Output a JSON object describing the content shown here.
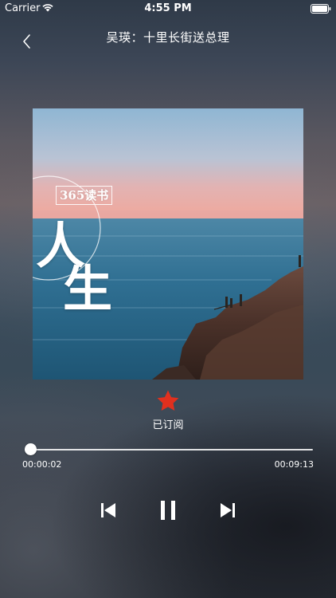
{
  "status_bar": {
    "carrier": "Carrier",
    "time": "4:55 PM",
    "icons": [
      "wifi-icon",
      "battery-icon"
    ]
  },
  "nav": {
    "back_icon": "chevron-left-icon",
    "title": "吴瑛：十里长街送总理"
  },
  "cover": {
    "stamp_text": "365读书",
    "big_char_1": "人",
    "big_char_2": "生"
  },
  "subscribe": {
    "icon": "star-icon",
    "label": "已订阅",
    "color": "#e0301e"
  },
  "player": {
    "elapsed": "00:00:02",
    "total": "00:09:13",
    "progress_fraction": 0.004,
    "controls": {
      "prev_icon": "skip-previous-icon",
      "pause_icon": "pause-icon",
      "next_icon": "skip-next-icon"
    }
  }
}
